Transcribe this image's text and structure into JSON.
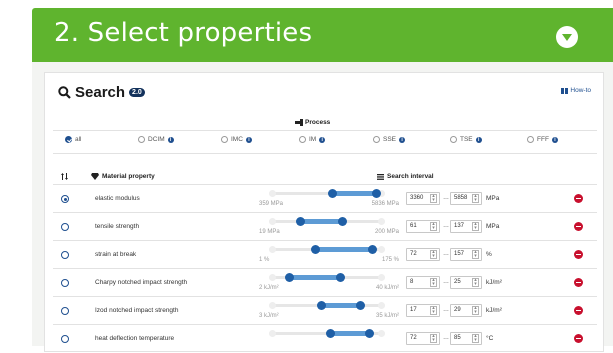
{
  "header": {
    "title": "2. Select properties"
  },
  "search": {
    "title": "Search",
    "badge": "2.0",
    "howto_label": "How-to"
  },
  "process": {
    "label": "Process",
    "options": [
      {
        "label": "all",
        "checked": true,
        "info": false
      },
      {
        "label": "DCIM",
        "checked": false,
        "info": true
      },
      {
        "label": "IMC",
        "checked": false,
        "info": true
      },
      {
        "label": "IM",
        "checked": false,
        "info": true
      },
      {
        "label": "SSE",
        "checked": false,
        "info": true
      },
      {
        "label": "TSE",
        "checked": false,
        "info": true
      },
      {
        "label": "FFF",
        "checked": false,
        "info": true
      }
    ]
  },
  "table": {
    "col_property": "Material property",
    "col_interval": "Search interval",
    "rows": [
      {
        "name": "elastic modulus",
        "selected": true,
        "min_label": "359 MPa",
        "max_label": "5836 MPa",
        "low": 0.55,
        "high": 0.93,
        "from": "3360",
        "to": "5858",
        "unit": "MPa"
      },
      {
        "name": "tensile strength",
        "selected": false,
        "min_label": "19 MPa",
        "max_label": "200 MPa",
        "low": 0.27,
        "high": 0.63,
        "from": "61",
        "to": "137",
        "unit": "MPa"
      },
      {
        "name": "strain at break",
        "selected": false,
        "min_label": "1 %",
        "max_label": "175 %",
        "low": 0.4,
        "high": 0.89,
        "from": "72",
        "to": "157",
        "unit": "%"
      },
      {
        "name": "Charpy notched impact strength",
        "selected": false,
        "min_label": "2 kJ/m²",
        "max_label": "40 kJ/m²",
        "low": 0.18,
        "high": 0.62,
        "from": "8",
        "to": "25",
        "unit": "kJ/m²"
      },
      {
        "name": "Izod notched impact strength",
        "selected": false,
        "min_label": "3 kJ/m²",
        "max_label": "35 kJ/m²",
        "low": 0.45,
        "high": 0.79,
        "from": "17",
        "to": "29",
        "unit": "kJ/m²"
      },
      {
        "name": "heat deflection temperature",
        "selected": false,
        "min_label": "",
        "max_label": "",
        "low": 0.53,
        "high": 0.87,
        "from": "72",
        "to": "85",
        "unit": "°C"
      }
    ]
  },
  "colors": {
    "brand_green": "#5fb42e",
    "accent_blue": "#1f5fa6",
    "range_blue": "#5d9bd5",
    "delete_red": "#c8102e"
  }
}
